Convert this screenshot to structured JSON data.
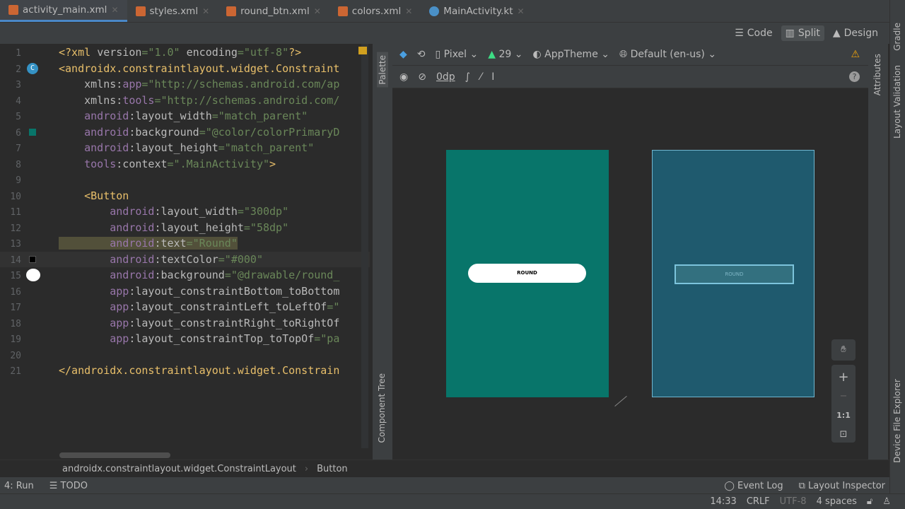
{
  "tabs": [
    {
      "label": "activity_main.xml",
      "type": "xml",
      "active": true
    },
    {
      "label": "styles.xml",
      "type": "xml"
    },
    {
      "label": "round_btn.xml",
      "type": "xml"
    },
    {
      "label": "colors.xml",
      "type": "xml"
    },
    {
      "label": "MainActivity.kt",
      "type": "kotlin"
    }
  ],
  "view_modes": {
    "code": "Code",
    "split": "Split",
    "design": "Design"
  },
  "code_lines": [
    [
      [
        "t",
        "<?xml "
      ],
      [
        "a",
        "version"
      ],
      [
        "v",
        "=\"1.0\" "
      ],
      [
        "a",
        "encoding"
      ],
      [
        "v",
        "=\"utf-8\""
      ],
      [
        "t",
        "?>"
      ]
    ],
    [
      [
        "t",
        "<androidx.constraintlayout.widget.Constraint"
      ]
    ],
    [
      [
        "a",
        "    xmlns:"
      ],
      [
        "ns",
        "app"
      ],
      [
        "v",
        "=\"http://schemas.android.com/ap"
      ]
    ],
    [
      [
        "a",
        "    xmlns:"
      ],
      [
        "ns",
        "tools"
      ],
      [
        "v",
        "=\"http://schemas.android.com/"
      ]
    ],
    [
      [
        "ns",
        "    android"
      ],
      [
        "a",
        ":layout_width"
      ],
      [
        "v",
        "=\"match_parent\""
      ]
    ],
    [
      [
        "ns",
        "    android"
      ],
      [
        "a",
        ":background"
      ],
      [
        "v",
        "=\"@color/colorPrimaryD"
      ]
    ],
    [
      [
        "ns",
        "    android"
      ],
      [
        "a",
        ":layout_height"
      ],
      [
        "v",
        "=\"match_parent\""
      ]
    ],
    [
      [
        "ns",
        "    tools"
      ],
      [
        "a",
        ":context"
      ],
      [
        "v",
        "=\".MainActivity\""
      ],
      [
        "t",
        ">"
      ]
    ],
    [],
    [
      [
        "t",
        "    <Button"
      ]
    ],
    [
      [
        "ns",
        "        android"
      ],
      [
        "a",
        ":layout_width"
      ],
      [
        "v",
        "=\"300dp\""
      ]
    ],
    [
      [
        "ns",
        "        android"
      ],
      [
        "a",
        ":layout_height"
      ],
      [
        "v",
        "=\"58dp\""
      ]
    ],
    [
      [
        "ns",
        "        android"
      ],
      [
        "a",
        ":text"
      ],
      [
        "v",
        "=\"Round\""
      ]
    ],
    [
      [
        "ns",
        "        android"
      ],
      [
        "a",
        ":textColor"
      ],
      [
        "v",
        "=\"#000\""
      ]
    ],
    [
      [
        "ns",
        "        android"
      ],
      [
        "a",
        ":background"
      ],
      [
        "v",
        "=\"@drawable/round_"
      ]
    ],
    [
      [
        "ns",
        "        app"
      ],
      [
        "a",
        ":layout_constraintBottom_toBottom"
      ]
    ],
    [
      [
        "ns",
        "        app"
      ],
      [
        "a",
        ":layout_constraintLeft_toLeftOf"
      ],
      [
        "v",
        "=\""
      ]
    ],
    [
      [
        "ns",
        "        app"
      ],
      [
        "a",
        ":layout_constraintRight_toRightOf"
      ]
    ],
    [
      [
        "ns",
        "        app"
      ],
      [
        "a",
        ":layout_constraintTop_toTopOf"
      ],
      [
        "v",
        "=\"pa"
      ]
    ],
    [],
    [
      [
        "t",
        "</androidx.constraintlayout.widget.Constrain"
      ]
    ]
  ],
  "side_panels": {
    "palette": "Palette",
    "component_tree": "Component Tree",
    "attributes": "Attributes",
    "gradle": "Gradle",
    "layout_validation": "Layout Validation",
    "device_file_explorer": "Device File Explorer"
  },
  "design_toolbar": {
    "device": "Pixel",
    "api": "29",
    "theme": "AppTheme",
    "locale": "Default (en-us)",
    "margin": "0dp"
  },
  "preview": {
    "button_text": "ROUND",
    "design_bg": "#08756a",
    "blueprint_bg": "#1f5a6e"
  },
  "zoom_controls": {
    "one_to_one": "1:1"
  },
  "breadcrumb": [
    "androidx.constraintlayout.widget.ConstraintLayout",
    "Button"
  ],
  "bottom_tools": {
    "run": "4: Run",
    "todo": "TODO",
    "event_log": "Event Log",
    "layout_inspector": "Layout Inspector"
  },
  "status": {
    "position": "14:33",
    "line_sep": "CRLF",
    "encoding": "UTF-8",
    "indent": "4 spaces"
  }
}
